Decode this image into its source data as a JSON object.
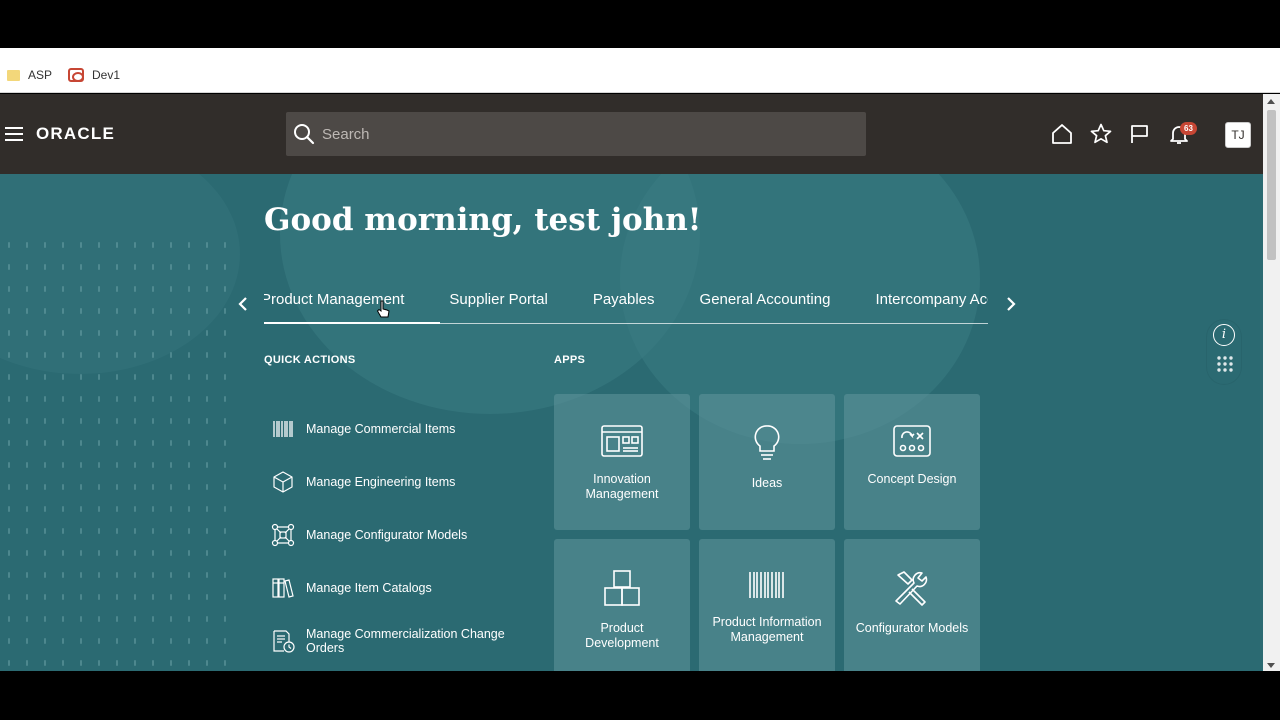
{
  "bookmarks": [
    {
      "label": "ASP",
      "icon": "folder-icon"
    },
    {
      "label": "Dev1",
      "icon": "oracle-icon"
    }
  ],
  "header": {
    "brand": "ORACLE",
    "search_placeholder": "Search",
    "notification_count": "63",
    "avatar_initials": "TJ"
  },
  "hero": {
    "greeting": "Good morning, test john!"
  },
  "tabs": [
    {
      "label": "Product Management",
      "active": true
    },
    {
      "label": "Supplier Portal"
    },
    {
      "label": "Payables"
    },
    {
      "label": "General Accounting"
    },
    {
      "label": "Intercompany Accounting"
    }
  ],
  "quick_actions": {
    "title": "QUICK ACTIONS",
    "items": [
      {
        "label": "Manage Commercial Items",
        "icon": "barcode-icon"
      },
      {
        "label": "Manage Engineering Items",
        "icon": "cube-icon"
      },
      {
        "label": "Manage Configurator Models",
        "icon": "nodes-icon"
      },
      {
        "label": "Manage Item Catalogs",
        "icon": "books-icon"
      },
      {
        "label": "Manage Commercialization Change Orders",
        "icon": "document-clock-icon"
      }
    ]
  },
  "apps": {
    "title": "APPS",
    "tiles": [
      {
        "label": "Innovation Management",
        "icon": "dashboard-icon"
      },
      {
        "label": "Ideas",
        "icon": "lightbulb-icon"
      },
      {
        "label": "Concept Design",
        "icon": "concept-icon"
      },
      {
        "label": "Product Development",
        "icon": "boxes-icon"
      },
      {
        "label": "Product Information Management",
        "icon": "barcode-icon"
      },
      {
        "label": "Configurator Models",
        "icon": "tools-icon"
      }
    ]
  },
  "colors": {
    "topbar": "#312d2a",
    "hero": "#2b6a72",
    "badge": "#c74634"
  }
}
